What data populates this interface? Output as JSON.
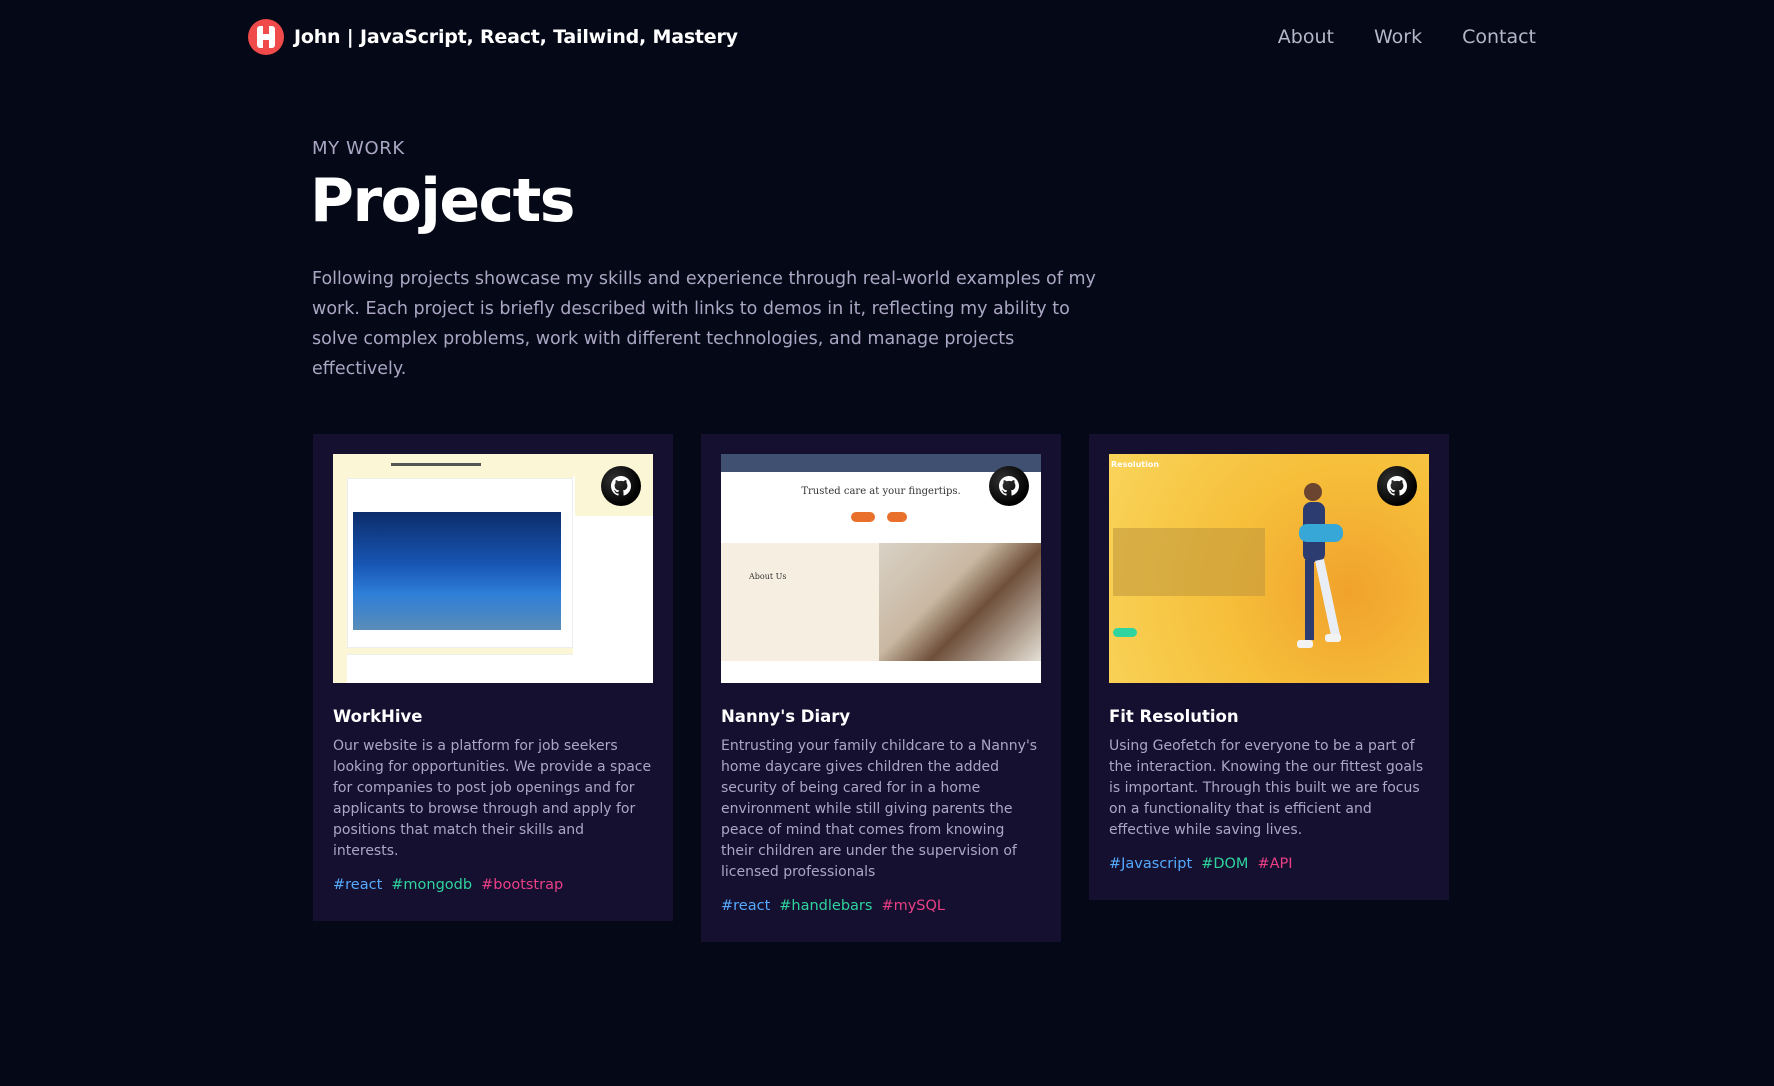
{
  "nav": {
    "brand": "John  | JavaScript, React, Tailwind, Mastery",
    "links": [
      "About",
      "Work",
      "Contact"
    ]
  },
  "header": {
    "subtitle": "MY WORK",
    "title": "Projects",
    "intro": "Following projects showcase my skills and experience through real-world examples of my work. Each project is briefly described with links to demos in it, reflecting my ability to solve complex problems, work with different technologies, and manage projects effectively."
  },
  "projects": [
    {
      "name": "WorkHive",
      "description": "Our website is a platform for job seekers looking for opportunities. We provide a space for companies to post job openings and for applicants to browse through and apply for positions that match their skills and interests.",
      "tags": [
        "#react",
        "#mongodb",
        "#bootstrap"
      ]
    },
    {
      "name": "Nanny's Diary",
      "description": "Entrusting your family childcare to a Nanny's home daycare gives children the added security of being cared for in a home environment while still giving parents the peace of mind that comes from knowing their children are under the supervision of licensed professionals",
      "tags": [
        "#react",
        "#handlebars",
        "#mySQL"
      ],
      "thumb_text": {
        "hero": "Trusted care at your fingertips.",
        "about": "About Us"
      }
    },
    {
      "name": "Fit Resolution",
      "description": "Using Geofetch for everyone to be a part of the interaction. Knowing the our fittest goals is important. Through this built we are focus on a functionality that is efficient and effective while saving lives.",
      "tags": [
        "#Javascript",
        "#DOM",
        "#API"
      ],
      "thumb_text": {
        "title": "Resolution"
      }
    }
  ],
  "colors": {
    "background": "#050816",
    "card": "#151030",
    "text_secondary": "#aaa6c3",
    "tag_blue": "#55aaff",
    "tag_green": "#2fd49e",
    "tag_pink": "#ec3f86",
    "logo": "#f04a4a"
  },
  "icons": {
    "logo": "logo-icon",
    "source": "github-icon"
  }
}
